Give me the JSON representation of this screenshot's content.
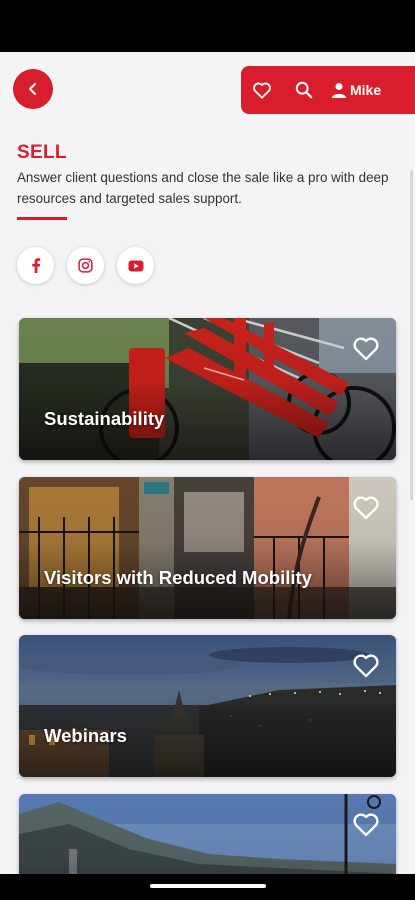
{
  "header": {
    "back_icon": "chevron-left-icon",
    "favorites_icon": "heart-outline-icon",
    "search_icon": "search-icon",
    "user_icon": "person-icon",
    "user_name": "Mike"
  },
  "section": {
    "title": "SELL",
    "description": "Answer client questions and close the sale like a pro with deep resources and targeted sales support."
  },
  "social": [
    "facebook-icon",
    "instagram-icon",
    "youtube-icon"
  ],
  "cards": [
    {
      "title": "Sustainability",
      "image": "red-bicycles-photo",
      "fav_icon": "heart-outline-icon"
    },
    {
      "title": "Visitors with Reduced Mobility",
      "image": "street-gate-photo",
      "fav_icon": "heart-outline-icon"
    },
    {
      "title": "Webinars",
      "image": "harbor-dusk-photo",
      "fav_icon": "heart-outline-icon"
    },
    {
      "title": "",
      "image": "mountain-coast-photo",
      "fav_icon": "heart-outline-icon"
    }
  ],
  "colors": {
    "brand": "#d81e2c",
    "background": "#f4f4f6"
  }
}
